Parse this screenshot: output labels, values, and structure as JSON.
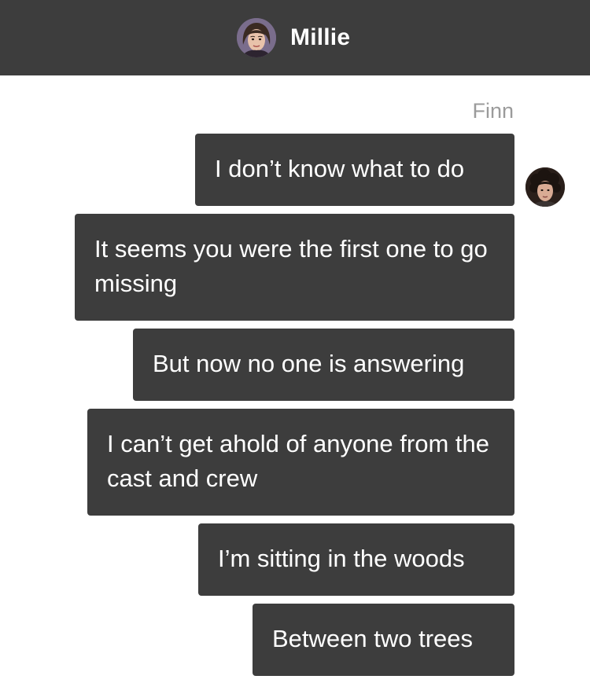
{
  "header": {
    "title": "Millie",
    "avatar_icon": "millie-avatar"
  },
  "conversation": {
    "sender_name": "Finn",
    "sender_avatar_icon": "finn-avatar",
    "messages": [
      "I don’t know what to do",
      "It seems you were the first one to go missing",
      "But now no one is answering",
      "I can’t get ahold of anyone from the cast and crew",
      "I’m sitting in the woods",
      "Between two trees"
    ]
  },
  "colors": {
    "header_bg": "#3d3d3d",
    "bubble_bg": "#3d3d3d",
    "bubble_text": "#ffffff",
    "sender_name": "#9b9b9b"
  }
}
